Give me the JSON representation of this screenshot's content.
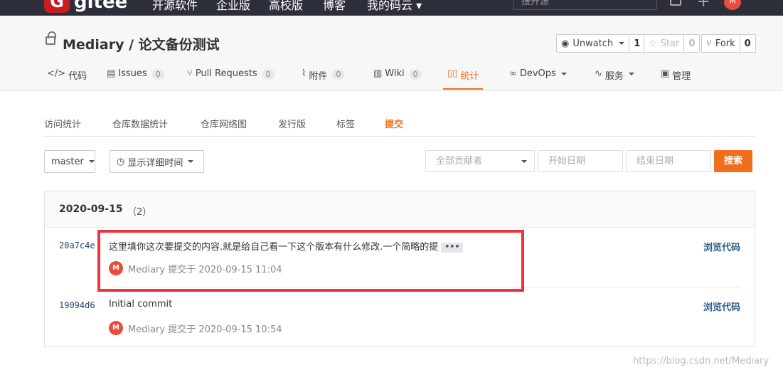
{
  "topnav": {
    "logo_glyph": "G",
    "brand": "gitee",
    "items": [
      "开源软件",
      "企业版",
      "高校版",
      "博客",
      "我的码云"
    ],
    "search_placeholder": "搜开源",
    "avatar": "M"
  },
  "project": {
    "title": "Mediary / 论文备份测试",
    "watch": {
      "label": "Unwatch",
      "count": "1"
    },
    "star": {
      "label": "Star",
      "count": "0"
    },
    "fork": {
      "label": "Fork",
      "count": "0"
    },
    "tabs": [
      {
        "icon": "</>",
        "label": "代码",
        "badge": ""
      },
      {
        "icon": "▤",
        "label": "Issues",
        "badge": "0"
      },
      {
        "icon": "⑂",
        "label": "Pull Requests",
        "badge": "0"
      },
      {
        "icon": "⌇",
        "label": "附件",
        "badge": "0"
      },
      {
        "icon": "▥",
        "label": "Wiki",
        "badge": "0"
      },
      {
        "icon": "▯▯",
        "label": "统计",
        "badge": ""
      },
      {
        "icon": "∞",
        "label": "DevOps",
        "badge": ""
      },
      {
        "icon": "∿",
        "label": "服务",
        "badge": ""
      },
      {
        "icon": "▣",
        "label": "管理",
        "badge": ""
      }
    ]
  },
  "subtabs": [
    "访问统计",
    "仓库数据统计",
    "仓库网络图",
    "发行版",
    "标签",
    "提交"
  ],
  "filters": {
    "branch": "master",
    "time_toggle": "显示详细时间",
    "contributors": "全部贡献者",
    "start_date": "开始日期",
    "end_date": "结束日期",
    "search": "搜索"
  },
  "commits": {
    "date": "2020-09-15",
    "count": "（2）",
    "browse_label": "浏览代码",
    "items": [
      {
        "sha": "20a7c4e",
        "message": "这里填你这次要提交的内容.就是给自己看一下这个版本有什么修改.一个简略的提",
        "more": "•••",
        "avatar": "M",
        "meta": "Mediary 提交于 2020-09-15 11:04"
      },
      {
        "sha": "19094d6",
        "message": "Initial commit",
        "more": "",
        "avatar": "M",
        "meta": "Mediary 提交于 2020-09-15 10:54"
      }
    ]
  },
  "watermark": "https://blog.csdn.net/Mediary",
  "colors": {
    "accent": "#f06e1e",
    "highlight": "#f0323a",
    "nav": "#2c2f3a"
  }
}
